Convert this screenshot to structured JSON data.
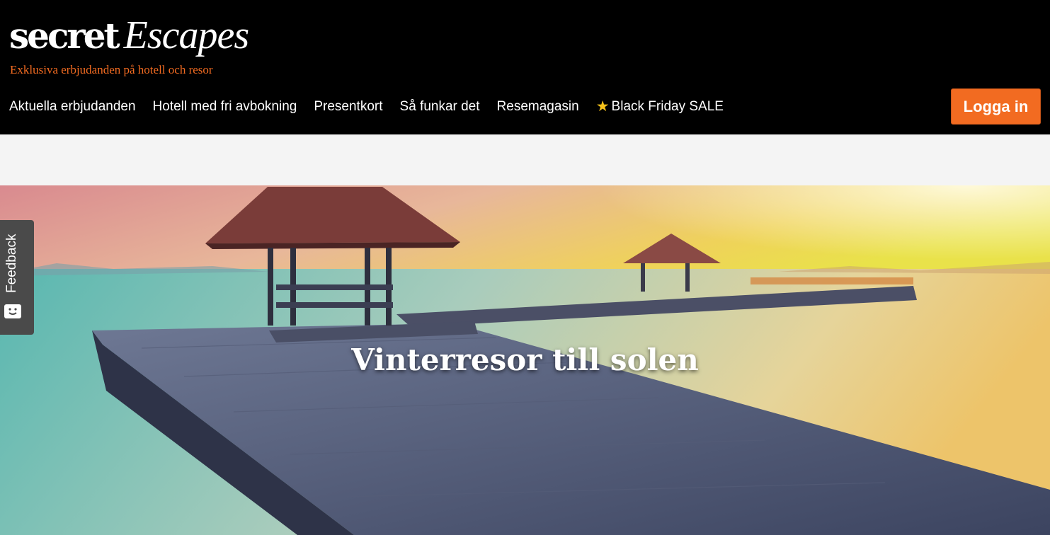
{
  "brand": {
    "logo_secret": "secret",
    "logo_escapes": "Escapes",
    "tagline": "Exklusiva erbjudanden på hotell och resor",
    "accent_color": "#f26b21"
  },
  "nav": {
    "items": [
      {
        "label": "Aktuella erbjudanden"
      },
      {
        "label": "Hotell med fri avbokning"
      },
      {
        "label": "Presentkort"
      },
      {
        "label": "Så funkar det"
      },
      {
        "label": "Resemagasin"
      },
      {
        "label": "Black Friday SALE",
        "icon": "star-icon"
      }
    ],
    "login_label": "Logga in"
  },
  "hero": {
    "title": "Vinterresor till solen"
  },
  "feedback": {
    "label": "Feedback",
    "icon": "chat-face-icon"
  }
}
